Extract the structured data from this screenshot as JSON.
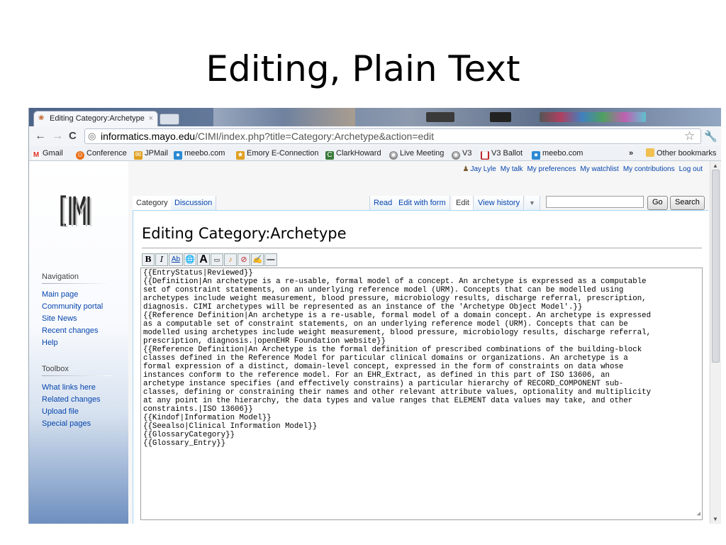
{
  "slide": {
    "title": "Editing, Plain Text"
  },
  "browser": {
    "tab": {
      "title": "Editing Category:Archetype",
      "close": "×"
    },
    "address": {
      "host": "informatics.mayo.edu",
      "path": "/CIMI/index.php?title=Category:Archetype&action=edit"
    },
    "nav": {
      "back": "←",
      "forward": "→",
      "reload": "C"
    },
    "bookmarks": [
      {
        "label": "Gmail",
        "icon": "gmail-icon",
        "color": "#d93025"
      },
      {
        "label": "Conference",
        "icon": "conference-icon",
        "color": "#e8711a"
      },
      {
        "label": "JPMail",
        "icon": "jpmail-icon",
        "color": "#e0a020"
      },
      {
        "label": "meebo.com",
        "icon": "meebo-icon",
        "color": "#2a8ad4"
      },
      {
        "label": "Emory E-Connection",
        "icon": "emory-icon",
        "color": "#e0a020"
      },
      {
        "label": "ClarkHoward",
        "icon": "clarkhoward-icon",
        "color": "#3a7a3a"
      },
      {
        "label": "Live Meeting",
        "icon": "live-meeting-icon",
        "color": "#888888"
      },
      {
        "label": "V3",
        "icon": "v3-icon",
        "color": "#888888"
      },
      {
        "label": "V3 Ballot",
        "icon": "v3-ballot-icon",
        "color": "#c0282d"
      },
      {
        "label": "meebo.com",
        "icon": "meebo-icon",
        "color": "#2a8ad4"
      }
    ],
    "bookmarks_more": "»",
    "other_bookmarks": "Other bookmarks"
  },
  "wiki": {
    "logo_text": "CIMI",
    "user_links": [
      "Jay Lyle",
      "My talk",
      "My preferences",
      "My watchlist",
      "My contributions",
      "Log out"
    ],
    "tabs_left": [
      "Category",
      "Discussion"
    ],
    "tabs_right": [
      "Read",
      "Edit with form",
      "Edit",
      "View history"
    ],
    "search": {
      "go": "Go",
      "search": "Search"
    },
    "heading": "Editing Category:Archetype",
    "navigation": {
      "title": "Navigation",
      "items": [
        "Main page",
        "Community portal",
        "Site News",
        "Recent changes",
        "Help"
      ]
    },
    "toolbox": {
      "title": "Toolbox",
      "items": [
        "What links here",
        "Related changes",
        "Upload file",
        "Special pages"
      ]
    },
    "edit_toolbar": [
      "B",
      "I",
      "Ab",
      "globe",
      "A",
      "img",
      "media",
      "sig",
      "sig2",
      "hr"
    ],
    "edit_text": "{{EntryStatus|Reviewed}}\n{{Definition|An archetype is a re-usable, formal model of a concept. An archetype is expressed as a computable\nset of constraint statements, on an underlying reference model (URM). Concepts that can be modelled using\narchetypes include weight measurement, blood pressure, microbiology results, discharge referral, prescription,\ndiagnosis. CIMI archetypes will be represented as an instance of the 'Archetype Object Model'.}}\n{{Reference Definition|An archetype is a re-usable, formal model of a domain concept. An archetype is expressed\nas a computable set of constraint statements, on an underlying reference model (URM). Concepts that can be\nmodelled using archetypes include weight measurement, blood pressure, microbiology results, discharge referral,\nprescription, diagnosis.|openEHR Foundation website}}\n{{Reference Definition|An Archetype is the formal definition of prescribed combinations of the building-block\nclasses defined in the Reference Model for particular clinical domains or organizations. An archetype is a\nformal expression of a distinct, domain-level concept, expressed in the form of constraints on data whose\ninstances conform to the reference model. For an EHR_Extract, as defined in this part of ISO 13606, an\narchetype instance specifies (and effectively constrains) a particular hierarchy of RECORD_COMPONENT sub-\nclasses, defining or constraining their names and other relevant attribute values, optionality and multiplicity\nat any point in the hierarchy, the data types and value ranges that ELEMENT data values may take, and other\nconstraints.|ISO 13606}}\n{{Kindof|Information Model}}\n{{Seealso|Clinical Information Model}}\n{{GlossaryCategory}}\n{{Glossary_Entry}}"
  },
  "colors": {
    "link": "#0645ad",
    "sidebar_bottom": "#6e8fbf",
    "tab_border": "#a7d7f9"
  }
}
